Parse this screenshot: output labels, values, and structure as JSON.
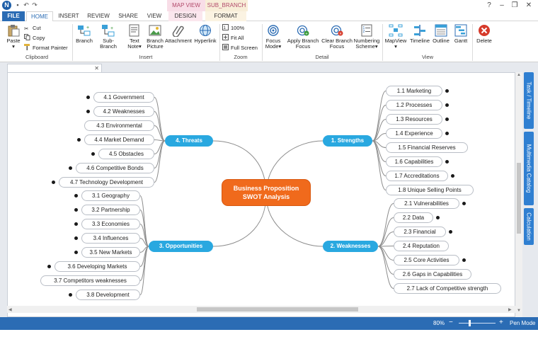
{
  "app": {
    "logo": "N",
    "context_tabs": [
      "MAP VIEW",
      "SUB_BRANCH"
    ],
    "window_buttons": [
      "?",
      "–",
      "❐",
      "✕"
    ],
    "tabs": [
      "FILE",
      "HOME",
      "INSERT",
      "REVIEW",
      "SHARE",
      "VIEW",
      "DESIGN",
      "FORMAT"
    ]
  },
  "ribbon": {
    "clipboard": {
      "label": "Clipboard",
      "paste": "Paste",
      "cut": "Cut",
      "copy": "Copy",
      "format_painter": "Format Painter"
    },
    "insert": {
      "label": "Insert",
      "branch": "Branch",
      "sub_branch": "Sub-Branch",
      "text_note_1": "Text",
      "text_note_2": "Note",
      "branch_picture_1": "Branch",
      "branch_picture_2": "Picture",
      "attachment": "Attachment",
      "hyperlink": "Hyperlink"
    },
    "zoom": {
      "label": "Zoom",
      "pct": "100%",
      "fit_all": "Fit All",
      "full_screen": "Full Screen"
    },
    "detail": {
      "label": "Detail",
      "focus_mode_1": "Focus",
      "focus_mode_2": "Mode",
      "apply_focus_1": "Apply Branch",
      "apply_focus_2": "Focus",
      "clear_focus_1": "Clear Branch",
      "clear_focus_2": "Focus",
      "numbering_1": "Numbering",
      "numbering_2": "Scheme"
    },
    "view": {
      "label": "View",
      "mapview": "MapView",
      "timeline": "Timeline",
      "outline": "Outline",
      "gantt": "Gantt"
    },
    "delete": "Delete"
  },
  "side_tabs": [
    "Task / Timeline",
    "Multimedia Catalog",
    "Calculation"
  ],
  "status": {
    "zoom": "80%",
    "minus": "−",
    "plus": "+",
    "pen_mode": "Pen Mode"
  },
  "colors": {
    "accent": "#2b6cb4",
    "main_branch": "#29a8e0",
    "center": "#f06a1c"
  },
  "mindmap": {
    "center_line1": "Business Proposition",
    "center_line2": "SWOT Analysis",
    "strengths": {
      "title": "1.  Strengths",
      "items": [
        "1.1  Marketing",
        "1.2  Processes",
        "1.3  Resources",
        "1.4  Experience",
        "1.5  Financial Reserves",
        "1.6  Capabilities",
        "1.7  Accreditations",
        "1.8  Unique Selling Points"
      ]
    },
    "weaknesses": {
      "title": "2.  Weaknesses",
      "items": [
        "2.1  Vulnerabilities",
        "2.2  Data",
        "2.3  Financial",
        "2.4  Reputation",
        "2.5  Core Activities",
        "2.6  Gaps in Capabilities",
        "2.7  Lack of Competitive strength"
      ]
    },
    "opportunities": {
      "title": "3.  Opportunities",
      "items": [
        "3.1  Geography",
        "3.2  Partnership",
        "3.3  Economies",
        "3.4  Influences",
        "3.5  New Markets",
        "3.6  Developing Markets",
        "3.7  Competitors weaknesses",
        "3.8  Development"
      ]
    },
    "threats": {
      "title": "4.  Threats",
      "items": [
        "4.1  Government",
        "4.2  Weaknesses",
        "4.3  Environmental",
        "4.4  Market Demand",
        "4.5  Obstacles",
        "4.6  Competitive Bonds",
        "4.7  Technology Development"
      ]
    }
  }
}
